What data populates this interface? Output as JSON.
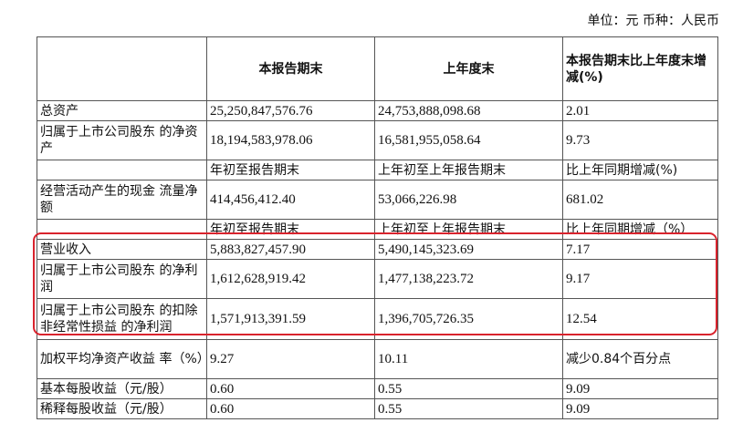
{
  "unit_label": "单位：元 币种：人民币",
  "header": [
    "",
    "本报告期末",
    "上年度末",
    "本报告期末比上年度末增减(%)"
  ],
  "rows": [
    {
      "type": "data",
      "cells": [
        "总资产",
        "25,250,847,576.76",
        "24,753,888,098.68",
        "2.01"
      ]
    },
    {
      "type": "data2",
      "cells": [
        "归属于上市公司股东 的净资产",
        "18,194,583,978.06",
        "16,581,955,058.64",
        "9.73"
      ]
    },
    {
      "type": "sub",
      "cells": [
        "",
        "年初至报告期末",
        "上年初至上年报告期末",
        "比上年同期增减(%)"
      ]
    },
    {
      "type": "data2",
      "cells": [
        "经营活动产生的现金 流量净额",
        "414,456,412.40",
        "53,066,226.98",
        "681.02"
      ]
    },
    {
      "type": "sub",
      "cells": [
        "",
        "年初至报告期末",
        "上年初至上年报告期末",
        "比上年同期增减（%）"
      ]
    },
    {
      "type": "data",
      "cells": [
        "营业收入",
        "5,883,827,457.90",
        "5,490,145,323.69",
        "7.17"
      ]
    },
    {
      "type": "data2",
      "cells": [
        "归属于上市公司股东 的净利润",
        "1,612,628,919.42",
        "1,477,138,223.72",
        "9.17"
      ]
    },
    {
      "type": "data3",
      "cells": [
        "归属于上市公司股东 的扣除非经常性损益 的净利润",
        "1,571,913,391.59",
        "1,396,705,726.35",
        "12.54"
      ]
    },
    {
      "type": "data2",
      "cells": [
        "加权平均净资产收益 率（%）",
        "9.27",
        "10.11",
        "减少0.84个百分点"
      ]
    },
    {
      "type": "data",
      "cells": [
        "基本每股收益（元/股）",
        "0.60",
        "0.55",
        "9.09"
      ]
    },
    {
      "type": "data",
      "cells": [
        "稀释每股收益（元/股）",
        "0.60",
        "0.55",
        "9.09"
      ]
    }
  ]
}
